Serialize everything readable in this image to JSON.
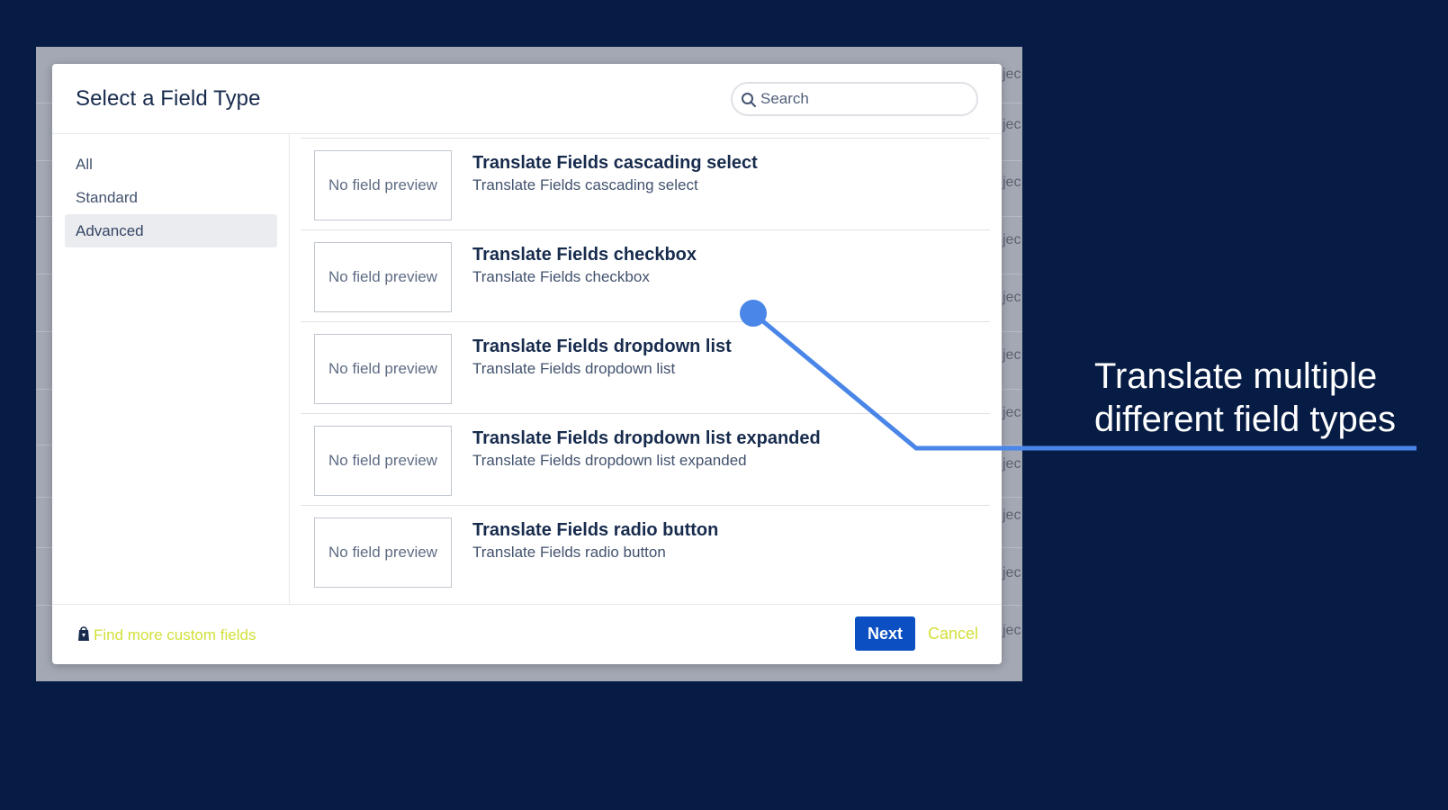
{
  "backdrop": {
    "rows": [
      {
        "text": "jec"
      },
      {
        "text": "jec"
      },
      {
        "text": "jec"
      },
      {
        "text": "jec"
      },
      {
        "text": "jec"
      },
      {
        "text": "jec"
      },
      {
        "text": "jec"
      },
      {
        "text": "jec"
      },
      {
        "text": "jec"
      },
      {
        "text": "jec"
      },
      {
        "text": "jec"
      }
    ]
  },
  "modal": {
    "title": "Select a Field Type",
    "search": {
      "placeholder": "Search",
      "value": ""
    }
  },
  "sidebar": {
    "items": [
      {
        "label": "All",
        "active": false
      },
      {
        "label": "Standard",
        "active": false
      },
      {
        "label": "Advanced",
        "active": true
      }
    ]
  },
  "fields": [
    {
      "preview": "No field preview",
      "title": "Translate Fields cascading select",
      "description": "Translate Fields cascading select"
    },
    {
      "preview": "No field preview",
      "title": "Translate Fields checkbox",
      "description": "Translate Fields checkbox"
    },
    {
      "preview": "No field preview",
      "title": "Translate Fields dropdown list",
      "description": "Translate Fields dropdown list"
    },
    {
      "preview": "No field preview",
      "title": "Translate Fields dropdown list expanded",
      "description": "Translate Fields dropdown list expanded"
    },
    {
      "preview": "No field preview",
      "title": "Translate Fields radio button",
      "description": "Translate Fields radio button"
    }
  ],
  "footer": {
    "find_more": "Find more custom fields",
    "next": "Next",
    "cancel": "Cancel"
  },
  "callout": {
    "line1": "Translate multiple",
    "line2": "different field types"
  },
  "colors": {
    "background": "#061c45",
    "primary_button": "#0b4fc3",
    "link": "#d3e03a",
    "callout_line": "#4a86e8"
  }
}
